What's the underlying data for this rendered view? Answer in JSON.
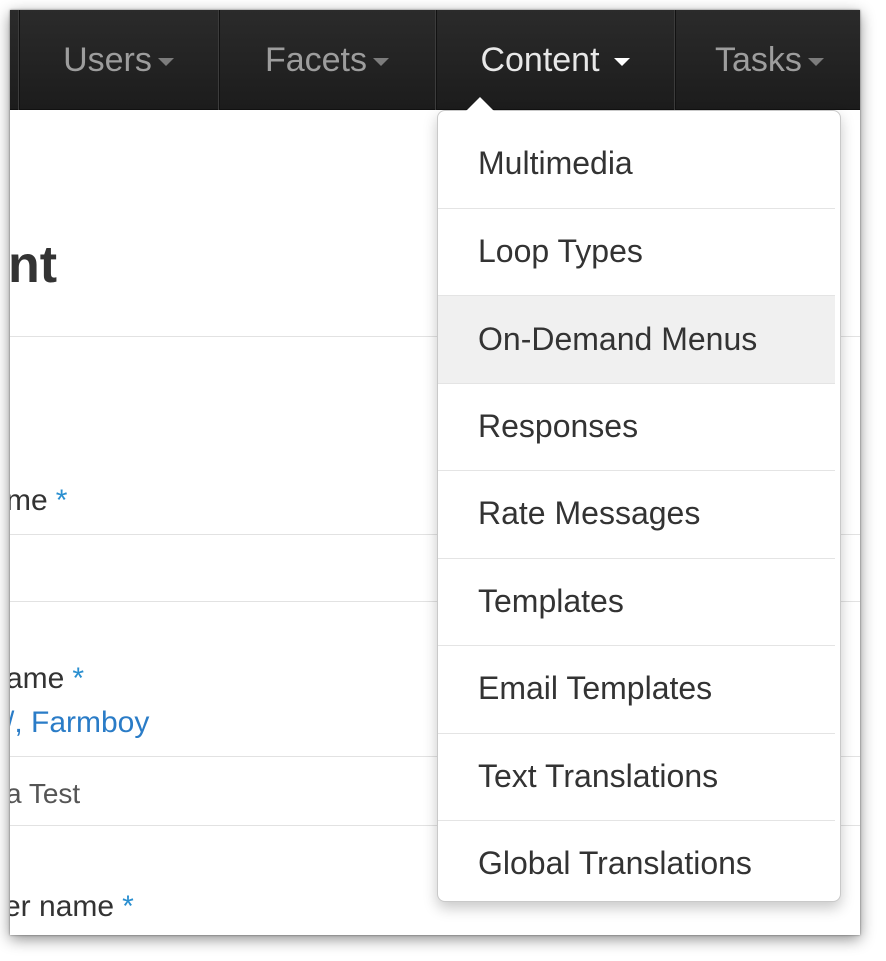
{
  "navbar": {
    "items": [
      {
        "label": "Users",
        "active": false
      },
      {
        "label": "Facets",
        "active": false
      },
      {
        "label": "Content",
        "active": true
      },
      {
        "label": "Tasks",
        "active": false
      }
    ]
  },
  "page": {
    "heading_fragment": "nt",
    "link_fragment_1": ":",
    "field_1_label": "me",
    "field_2_label": "ame",
    "field_2_value": "/, Farmboy",
    "field_3_value": "a Test",
    "field_4_label": "er name",
    "required_marker": "*"
  },
  "dropdown": {
    "items": [
      {
        "label": "Multimedia",
        "highlighted": false
      },
      {
        "label": "Loop Types",
        "highlighted": false
      },
      {
        "label": "On-Demand Menus",
        "highlighted": true
      },
      {
        "label": "Responses",
        "highlighted": false
      },
      {
        "label": "Rate Messages",
        "highlighted": false
      },
      {
        "label": "Templates",
        "highlighted": false
      },
      {
        "label": "Email Templates",
        "highlighted": false
      },
      {
        "label": "Text Translations",
        "highlighted": false
      },
      {
        "label": "Global Translations",
        "highlighted": false
      }
    ]
  },
  "colors": {
    "navbar_bg": "#222222",
    "nav_text": "#9d9d9d",
    "nav_text_active": "#ffffff",
    "link": "#2a7cc7",
    "required": "#2a8fd0",
    "menu_highlight": "#f0f0f0"
  }
}
